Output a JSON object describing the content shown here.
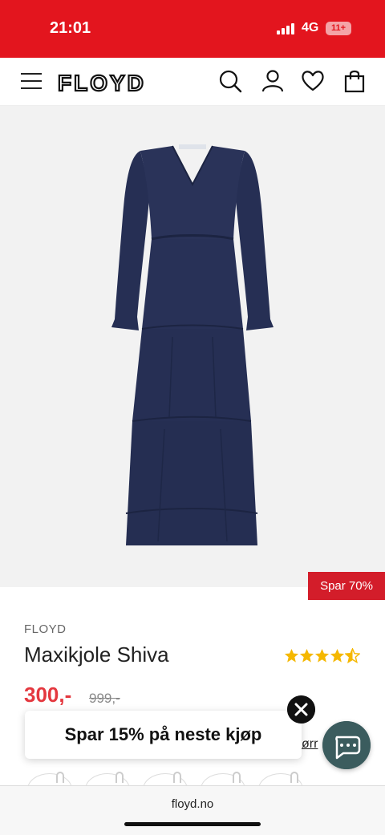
{
  "status_bar": {
    "time": "21:01",
    "network": "4G",
    "battery": "11+"
  },
  "header": {
    "logo_text": "FLOYD",
    "icons": [
      "menu-icon",
      "search-icon",
      "account-icon",
      "heart-icon",
      "bag-icon"
    ]
  },
  "product": {
    "discount_badge": "Spar 70%",
    "brand": "FLOYD",
    "title": "Maxikjole Shiva",
    "rating": 4.5,
    "price": "300,-",
    "old_price": "999,-",
    "size_guide_partial": "ørr"
  },
  "promo": {
    "text": "Spar 15% på neste kjøp"
  },
  "browser": {
    "url": "floyd.no"
  },
  "colors": {
    "brand_red": "#e3151e",
    "price_red": "#e4383f",
    "star_yellow": "#f5b800",
    "dress_navy": "#262f54",
    "chat_teal": "#3b5c5e"
  }
}
